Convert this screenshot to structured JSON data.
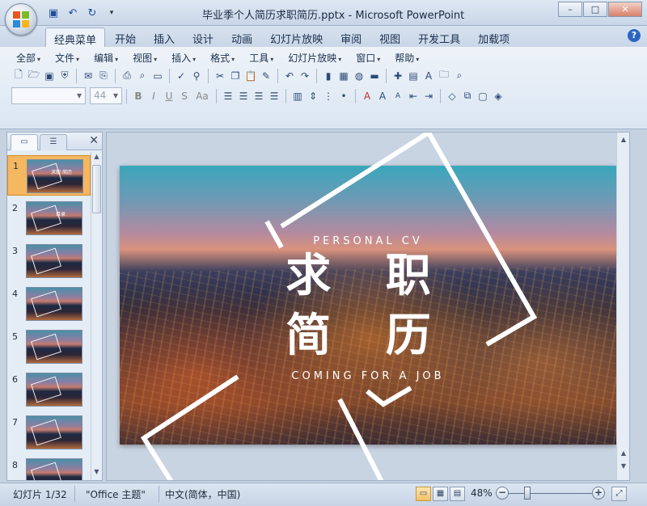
{
  "window": {
    "title": "毕业季个人简历求职简历.pptx - Microsoft PowerPoint",
    "controls": [
      "–",
      "□",
      "✕"
    ]
  },
  "quick_access": {
    "items": [
      "save-icon",
      "undo-icon",
      "redo-icon",
      "customize-icon"
    ]
  },
  "tabs": [
    "经典菜单",
    "开始",
    "插入",
    "设计",
    "动画",
    "幻灯片放映",
    "审阅",
    "视图",
    "开发工具",
    "加载项"
  ],
  "active_tab": "经典菜单",
  "help_label": "?",
  "menus": [
    "全部",
    "文件",
    "编辑",
    "视图",
    "插入",
    "格式",
    "工具",
    "幻灯片放映",
    "窗口",
    "帮助"
  ],
  "font": {
    "name": "",
    "size": "44"
  },
  "format_buttons": [
    "B",
    "I",
    "U",
    "S",
    "Aa"
  ],
  "left_pane": {
    "close_label": "✕",
    "slides": [
      {
        "num": "1",
        "caption": "求职 简历",
        "selected": true
      },
      {
        "num": "2",
        "caption": "目录",
        "selected": false
      },
      {
        "num": "3",
        "caption": "",
        "selected": false
      },
      {
        "num": "4",
        "caption": "",
        "selected": false
      },
      {
        "num": "5",
        "caption": "",
        "selected": false
      },
      {
        "num": "6",
        "caption": "",
        "selected": false
      },
      {
        "num": "7",
        "caption": "",
        "selected": false
      },
      {
        "num": "8",
        "caption": "",
        "selected": false
      }
    ]
  },
  "slide": {
    "subtitle_top": "PERSONAL CV",
    "line1": "求 职",
    "line2": "简 历",
    "subtitle_bottom": "COMING FOR A JOB"
  },
  "status": {
    "slide_counter": "幻灯片 1/32",
    "theme": "\"Office 主题\"",
    "language": "中文(简体，中国)",
    "zoom": "48%",
    "zoom_minus": "−",
    "zoom_plus": "+"
  }
}
